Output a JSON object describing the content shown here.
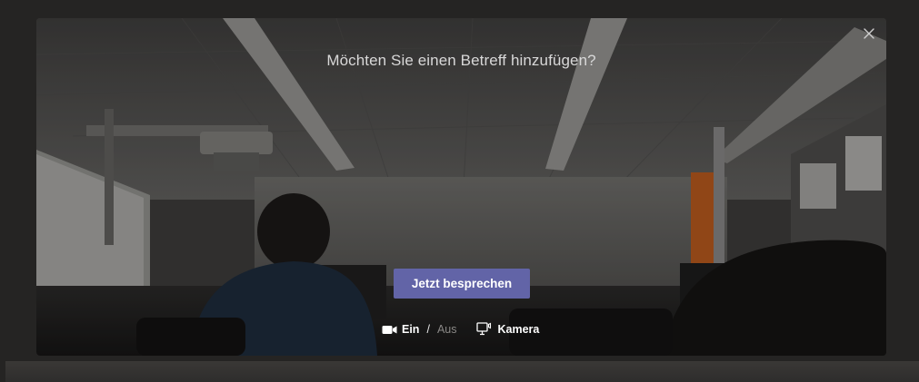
{
  "dialog": {
    "subject_prompt": "Möchten Sie einen Betreff hinzufügen?",
    "join_button_label": "Jetzt besprechen",
    "close_icon": "close-icon"
  },
  "video_controls": {
    "video_icon": "video-camera-icon",
    "on_label": "Ein",
    "separator": "/",
    "off_label": "Aus",
    "video_state": "on"
  },
  "camera": {
    "icon": "camera-device-icon",
    "label": "Kamera"
  },
  "colors": {
    "accent": "#6264a7",
    "background": "#252423",
    "text": "#ffffff",
    "muted_text": "#8a8886"
  }
}
